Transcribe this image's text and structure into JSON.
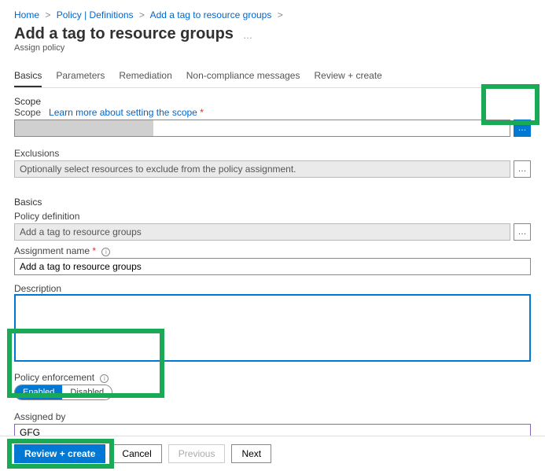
{
  "breadcrumb": {
    "home": "Home",
    "policy": "Policy | Definitions",
    "add": "Add a tag to resource groups"
  },
  "title": "Add a tag to resource groups",
  "subtitle": "Assign policy",
  "tabs": {
    "basics": "Basics",
    "parameters": "Parameters",
    "remediation": "Remediation",
    "noncompliance": "Non-compliance messages",
    "review": "Review + create"
  },
  "scope": {
    "heading": "Scope",
    "label": "Scope",
    "learn_more": "Learn more about setting the scope"
  },
  "exclusions": {
    "label": "Exclusions",
    "placeholder": "Optionally select resources to exclude from the policy assignment."
  },
  "basics": {
    "heading": "Basics",
    "policy_def_label": "Policy definition",
    "policy_def_value": "Add a tag to resource groups",
    "assign_name_label": "Assignment name",
    "assign_name_value": "Add a tag to resource groups",
    "description_label": "Description",
    "description_value": "",
    "enforcement_label": "Policy enforcement",
    "enabled": "Enabled",
    "disabled": "Disabled",
    "assigned_by_label": "Assigned by",
    "assigned_by_value": "GFG"
  },
  "footer": {
    "review": "Review + create",
    "cancel": "Cancel",
    "previous": "Previous",
    "next": "Next"
  }
}
